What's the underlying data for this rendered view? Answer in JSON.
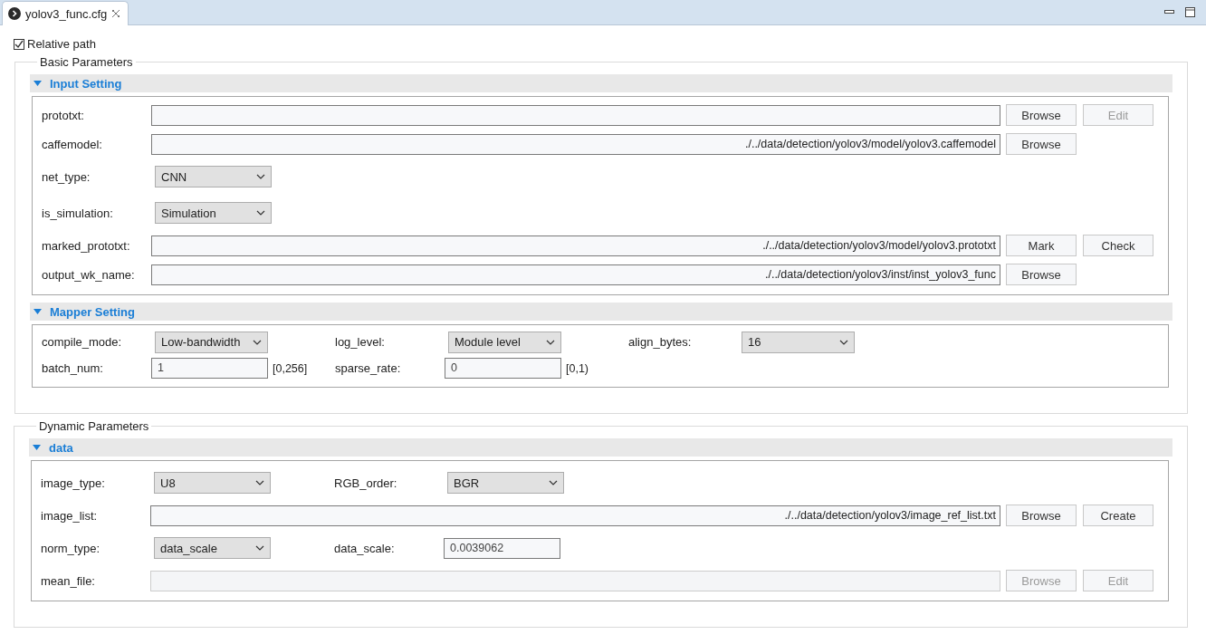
{
  "tab": {
    "title": "yolov3_func.cfg",
    "selected": true
  },
  "relative_path": {
    "label": "Relative path",
    "checked": true
  },
  "groups": [
    {
      "title": "Basic Parameters",
      "sections": [
        {
          "title": "Input Setting",
          "expanded": true,
          "rows": [
            {
              "kind": "path",
              "label": "prototxt:",
              "field": {
                "disabled": false
              },
              "buttons": [
                {
                  "label": "Browse",
                  "disabled": false
                },
                {
                  "label": "Edit",
                  "disabled": true
                }
              ]
            },
            {
              "kind": "path",
              "label": "caffemodel:",
              "field": {
                "value": "./../data/detection/yolov3/model/yolov3.caffemodel",
                "disabled": false
              },
              "buttons": [
                {
                  "label": "Browse",
                  "disabled": false
                }
              ]
            },
            {
              "kind": "pairs",
              "tall": true,
              "pairs": [
                {
                  "label": "net_type:",
                  "control": {
                    "kind": "select",
                    "value": "CNN"
                  }
                }
              ]
            },
            {
              "kind": "pairs",
              "tall": true,
              "pairs": [
                {
                  "label": "is_simulation:",
                  "control": {
                    "kind": "select",
                    "value": "Simulation"
                  }
                }
              ]
            },
            {
              "kind": "path",
              "label": "marked_prototxt:",
              "field": {
                "value": "./../data/detection/yolov3/model/yolov3.prototxt",
                "disabled": false
              },
              "buttons": [
                {
                  "label": "Mark",
                  "disabled": false
                },
                {
                  "label": "Check",
                  "disabled": false
                }
              ]
            },
            {
              "kind": "path",
              "label": "output_wk_name:",
              "field": {
                "value": "./../data/detection/yolov3/inst/inst_yolov3_func",
                "disabled": false
              },
              "buttons": [
                {
                  "label": "Browse",
                  "disabled": false
                }
              ]
            }
          ]
        },
        {
          "title": "Mapper Setting",
          "expanded": true,
          "rows": [
            {
              "kind": "pairs",
              "tall": false,
              "pairs": [
                {
                  "label": "compile_mode:",
                  "control": {
                    "kind": "select",
                    "value": "Low-bandwidth"
                  }
                },
                {
                  "label": "log_level:",
                  "control": {
                    "kind": "select",
                    "value": "Module level"
                  }
                },
                {
                  "label": "align_bytes:",
                  "control": {
                    "kind": "select",
                    "value": "16"
                  }
                }
              ]
            },
            {
              "kind": "pairs",
              "tall": false,
              "pairs": [
                {
                  "label": "batch_num:",
                  "control": {
                    "kind": "number",
                    "value": "1"
                  },
                  "note": "[0,256]"
                },
                {
                  "label": "sparse_rate:",
                  "control": {
                    "kind": "number",
                    "value": "0"
                  },
                  "note": "[0,1)"
                }
              ]
            }
          ]
        }
      ]
    },
    {
      "title": "Dynamic Parameters",
      "sections": [
        {
          "title": "data",
          "expanded": true,
          "rows": [
            {
              "kind": "pairs",
              "tall": true,
              "pairs": [
                {
                  "label": "image_type:",
                  "control": {
                    "kind": "select",
                    "value": "U8"
                  }
                },
                {
                  "label": "RGB_order:",
                  "control": {
                    "kind": "select",
                    "value": "BGR"
                  }
                }
              ]
            },
            {
              "kind": "path",
              "label": "image_list:",
              "field": {
                "value": "./../data/detection/yolov3/image_ref_list.txt",
                "disabled": false
              },
              "buttons": [
                {
                  "label": "Browse",
                  "disabled": false
                },
                {
                  "label": "Create",
                  "disabled": false
                }
              ]
            },
            {
              "kind": "pairs",
              "tall": true,
              "pairs": [
                {
                  "label": "norm_type:",
                  "control": {
                    "kind": "select",
                    "value": "data_scale"
                  }
                },
                {
                  "label": "data_scale:",
                  "control": {
                    "kind": "number",
                    "value": "0.0039062"
                  }
                }
              ]
            },
            {
              "kind": "path",
              "label": "mean_file:",
              "field": {
                "disabled": true
              },
              "buttons": [
                {
                  "label": "Browse",
                  "disabled": true
                },
                {
                  "label": "Edit",
                  "disabled": true
                }
              ]
            }
          ]
        }
      ]
    }
  ]
}
